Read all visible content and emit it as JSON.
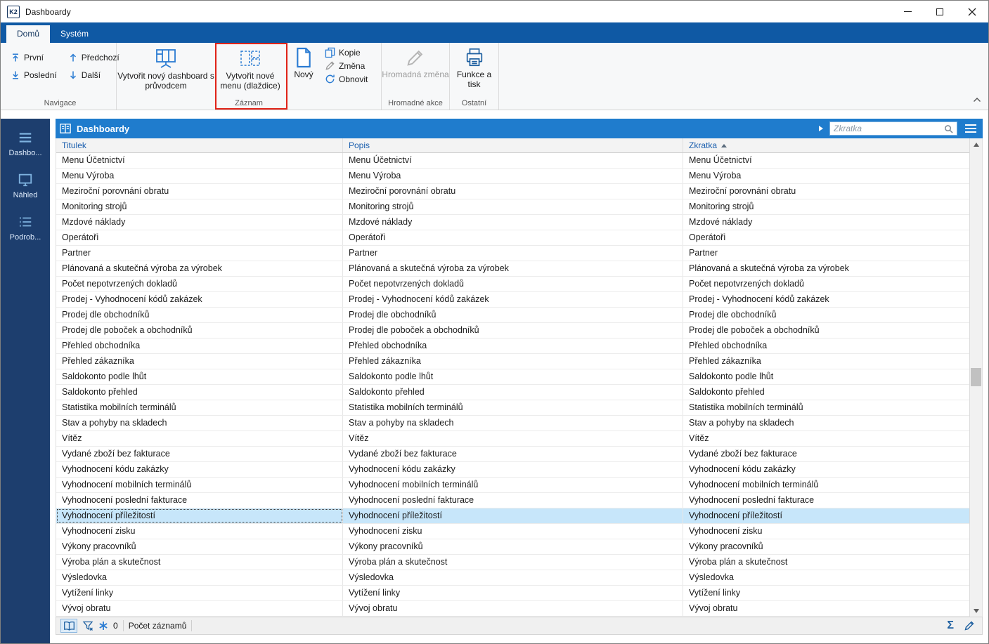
{
  "window": {
    "title": "Dashboardy",
    "app_badge": "K2"
  },
  "ribbon": {
    "tabs": [
      {
        "label": "Domů"
      },
      {
        "label": "Systém"
      }
    ],
    "navigace": {
      "group_label": "Navigace",
      "first": "První",
      "previous": "Předchozí",
      "last": "Poslední",
      "next": "Další"
    },
    "zaznam": {
      "group_label": "Záznam",
      "create_dashboard_wizard": "Vytvořit nový dashboard s průvodcem",
      "create_menu_tiles": "Vytvořit nové menu (dlaždice)",
      "new": "Nový",
      "copy": "Kopie",
      "change": "Změna",
      "refresh": "Obnovit"
    },
    "hromadne_akce": {
      "group_label": "Hromadné akce",
      "bulk_change": "Hromadná změna"
    },
    "ostatni": {
      "group_label": "Ostatní",
      "functions_print": "Funkce a tisk"
    }
  },
  "sidebar": {
    "items": [
      {
        "label": "Dashbo..."
      },
      {
        "label": "Náhled"
      },
      {
        "label": "Podrob..."
      }
    ]
  },
  "main": {
    "header_title": "Dashboardy",
    "search_placeholder": "Zkratka",
    "columns": {
      "title": "Titulek",
      "description": "Popis",
      "abbr": "Zkratka"
    },
    "sorted_column": "Zkratka",
    "sort_direction": "asc",
    "selected_index": 23,
    "rows": [
      "Menu Účetnictví",
      "Menu Výroba",
      "Meziroční porovnání obratu",
      "Monitoring strojů",
      "Mzdové náklady",
      "Operátoři",
      "Partner",
      "Plánovaná a skutečná výroba za výrobek",
      "Počet nepotvrzených dokladů",
      "Prodej - Vyhodnocení kódů zakázek",
      "Prodej dle obchodníků",
      "Prodej dle poboček a obchodníků",
      "Přehled obchodníka",
      "Přehled zákazníka",
      "Saldokonto podle lhůt",
      "Saldokonto přehled",
      "Statistika mobilních terminálů",
      "Stav a pohyby na skladech",
      "Vítěz",
      "Vydané zboží bez fakturace",
      "Vyhodnocení kódu zakázky",
      "Vyhodnocení mobilních terminálů",
      "Vyhodnocení poslední fakturace",
      "Vyhodnocení příležitostí",
      "Vyhodnocení zisku",
      "Výkony pracovníků",
      "Výroba plán a skutečnost",
      "Výsledovka",
      "Vytížení linky",
      "Vývoj obratu"
    ]
  },
  "statusbar": {
    "filter_count": "0",
    "records_label": "Počet záznamů",
    "sum_symbol": "Σ"
  },
  "colors": {
    "ribbon_bar": "#0f59a4",
    "panel_header": "#1f7ccd",
    "sidebar": "#1d3e6e",
    "selection": "#c7e6fa",
    "annotation": "#e02318",
    "icon_accent": "#2b7cd3",
    "column_header_text": "#1b5fae"
  }
}
